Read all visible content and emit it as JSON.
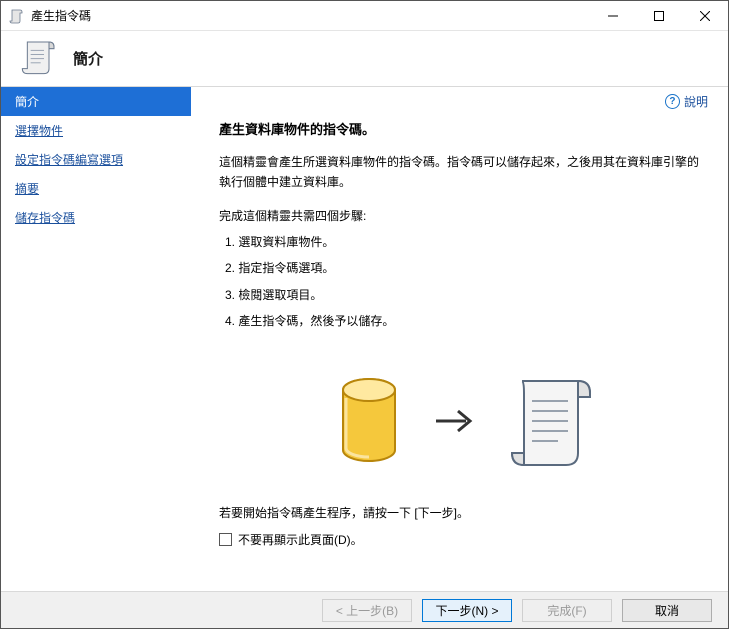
{
  "window": {
    "title": "產生指令碼"
  },
  "header": {
    "title": "簡介"
  },
  "help": {
    "label": "說明"
  },
  "sidebar": {
    "items": [
      {
        "label": "簡介",
        "active": true
      },
      {
        "label": "選擇物件",
        "active": false
      },
      {
        "label": "設定指令碼編寫選項",
        "active": false
      },
      {
        "label": "摘要",
        "active": false
      },
      {
        "label": "儲存指令碼",
        "active": false
      }
    ]
  },
  "content": {
    "heading": "產生資料庫物件的指令碼。",
    "description": "這個精靈會產生所選資料庫物件的指令碼。指令碼可以儲存起來，之後用其在資料庫引擎的執行個體中建立資料庫。",
    "steps_intro": "完成這個精靈共需四個步驟:",
    "steps": [
      "1. 選取資料庫物件。",
      "2. 指定指令碼選項。",
      "3. 檢閱選取項目。",
      "4. 產生指令碼，然後予以儲存。"
    ],
    "instruction": "若要開始指令碼產生程序，請按一下 [下一步]。",
    "checkbox_label": "不要再顯示此頁面(D)。"
  },
  "footer": {
    "back": "< 上一步(B)",
    "next": "下一步(N) >",
    "finish": "完成(F)",
    "cancel": "取消"
  }
}
